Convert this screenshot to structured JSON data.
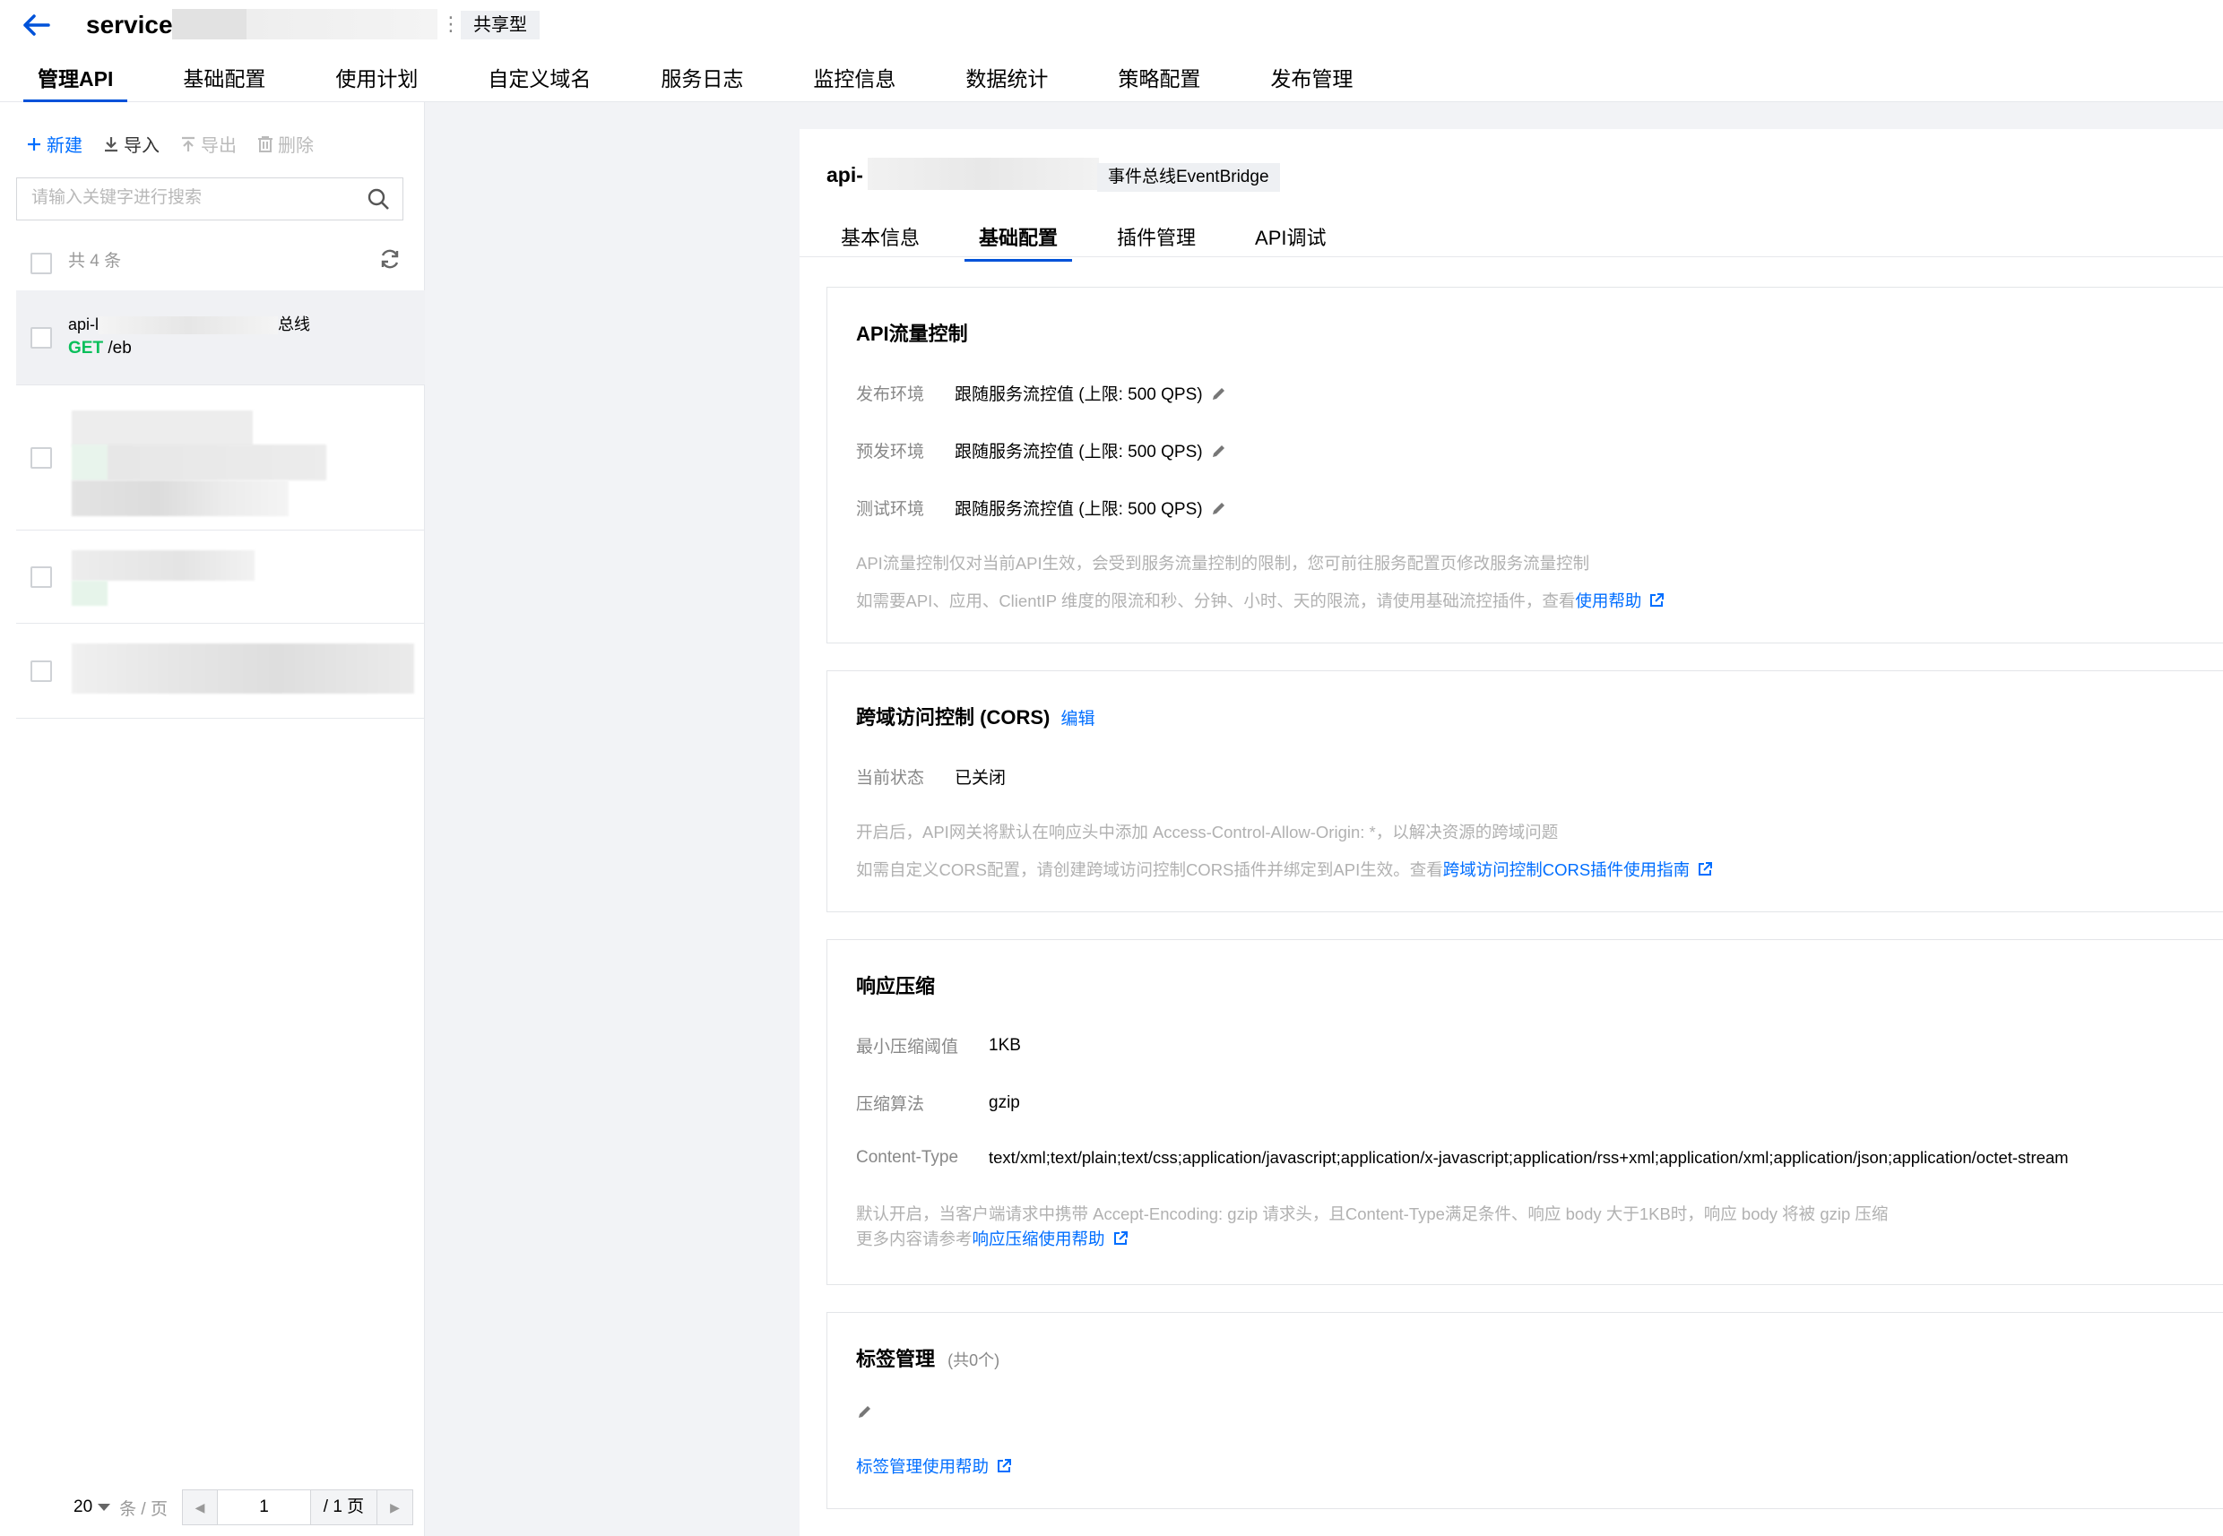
{
  "header": {
    "service_title": "service-",
    "service_badge": "共享型",
    "main_tabs": [
      "管理API",
      "基础配置",
      "使用计划",
      "自定义域名",
      "服务日志",
      "监控信息",
      "数据统计",
      "策略配置",
      "发布管理"
    ],
    "active_tab": "管理API"
  },
  "left": {
    "toolbar": {
      "new": "新建",
      "import": "导入",
      "export": "导出",
      "delete": "删除"
    },
    "search_placeholder": "请输入关键字进行搜索",
    "count_text": "共 4 条",
    "selected_item": {
      "name_prefix": "api-l",
      "name_suffix": "总线",
      "method": "GET",
      "path": "/eb"
    },
    "pager": {
      "page_size": "20",
      "unit": "条 / 页",
      "current_page": "1",
      "total": "/ 1 页"
    }
  },
  "api": {
    "title": "api-",
    "badge": "事件总线EventBridge",
    "tabs": [
      "基本信息",
      "基础配置",
      "插件管理",
      "API调试"
    ],
    "active_tab": "基础配置"
  },
  "rate_limit": {
    "title": "API流量控制",
    "rows": [
      {
        "label": "发布环境",
        "value": "跟随服务流控值 (上限: 500 QPS)"
      },
      {
        "label": "预发环境",
        "value": "跟随服务流控值 (上限: 500 QPS)"
      },
      {
        "label": "测试环境",
        "value": "跟随服务流控值 (上限: 500 QPS)"
      }
    ],
    "note1": "API流量控制仅对当前API生效，会受到服务流量控制的限制，您可前往服务配置页修改服务流量控制",
    "note2": "如需要API、应用、ClientIP 维度的限流和秒、分钟、小时、天的限流，请使用基础流控插件，查看",
    "note2_link": "使用帮助"
  },
  "cors": {
    "title": "跨域访问控制 (CORS)",
    "edit": "编辑",
    "status_label": "当前状态",
    "status_value": "已关闭",
    "note1": "开启后，API网关将默认在响应头中添加 Access-Control-Allow-Origin: *，以解决资源的跨域问题",
    "note2": "如需自定义CORS配置，请创建跨域访问控制CORS插件并绑定到API生效。查看",
    "note2_link": "跨域访问控制CORS插件使用指南"
  },
  "compression": {
    "title": "响应压缩",
    "rows": [
      {
        "label": "最小压缩阈值",
        "value": "1KB"
      },
      {
        "label": "压缩算法",
        "value": "gzip"
      },
      {
        "label": "Content-Type",
        "value": "text/xml;text/plain;text/css;application/javascript;application/x-javascript;application/rss+xml;application/xml;application/json;application/octet-stream"
      }
    ],
    "note1": "默认开启，当客户端请求中携带 Accept-Encoding: gzip 请求头，且Content-Type满足条件、响应 body 大于1KB时，响应 body 将被 gzip 压缩",
    "note2": "更多内容请参考",
    "note2_link": "响应压缩使用帮助"
  },
  "tags": {
    "title": "标签管理",
    "count": "(共0个)",
    "help_link": "标签管理使用帮助"
  },
  "colors": {
    "accent": "#0052d9",
    "link": "#006eff",
    "get_method": "#0abf5b"
  }
}
